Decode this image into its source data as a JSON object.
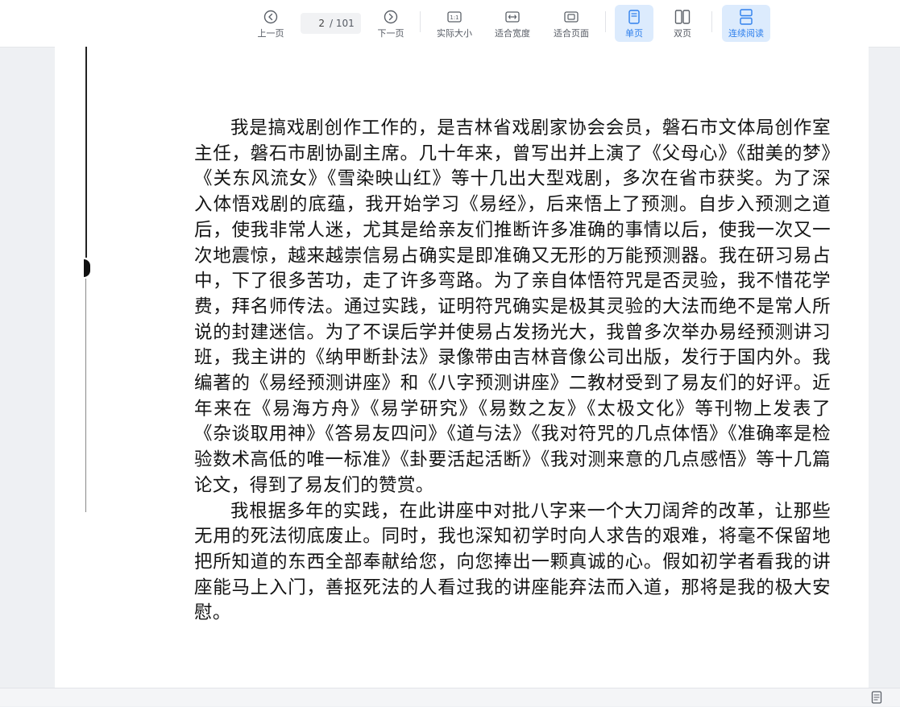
{
  "toolbar": {
    "prev_label": "上一页",
    "next_label": "下一页",
    "current_page": "2",
    "total_pages": "/ 101",
    "actual_size_label": "实际大小",
    "fit_width_label": "适合宽度",
    "fit_page_label": "适合页面",
    "single_page_label": "单页",
    "double_page_label": "双页",
    "continuous_label": "连续阅读",
    "icons": {
      "prev": "arrow-left-circle-icon",
      "next": "arrow-right-circle-icon",
      "actual_size": "one-to-one-icon",
      "fit_width": "fit-width-icon",
      "fit_page": "fit-page-icon",
      "single_page": "single-page-icon",
      "double_page": "double-page-icon",
      "continuous": "continuous-scroll-icon"
    },
    "accent_color": "#2f80ed"
  },
  "document": {
    "paragraphs": [
      "我是搞戏剧创作工作的，是吉林省戏剧家协会会员，磐石市文体局创作室主任，磐石市剧协副主席。几十年来，曾写出并上演了《父母心》《甜美的梦》《关东风流女》《雪染映山红》等十几出大型戏剧，多次在省市获奖。为了深入体悟戏剧的底蕴，我开始学习《易经》，后来悟上了预测。自步入预测之道后，使我非常人迷，尤其是给亲友们推断许多准确的事情以后，使我一次又一次地震惊，越来越崇信易占确实是即准确又无形的万能预测器。我在研习易占中，下了很多苦功，走了许多弯路。为了亲自体悟符咒是否灵验，我不惜花学费，拜名师传法。通过实践，证明符咒确实是极其灵验的大法而绝不是常人所说的封建迷信。为了不误后学并使易占发扬光大，我曾多次举办易经预测讲习班，我主讲的《纳甲断卦法》录像带由吉林音像公司出版，发行于国内外。我编著的《易经预测讲座》和《八字预测讲座》二教材受到了易友们的好评。近年来在《易海方舟》《易学研究》《易数之友》《太极文化》等刊物上发表了《杂谈取用神》《答易友四问》《道与法》《我对符咒的几点体悟》《准确率是检验数术高低的唯一标准》《卦要活起活断》《我对测来意的几点感悟》等十几篇论文，得到了易友们的赞赏。",
      "我根据多年的实践，在此讲座中对批八字来一个大刀阔斧的改革，让那些无用的死法彻底废止。同时，我也深知初学时向人求告的艰难，将毫不保留地把所知道的东西全部奉献给您，向您捧出一颗真诚的心。假如初学者看我的讲座能马上入门，善抠死法的人看过我的讲座能弃法而入道，那将是我的极大安慰。"
    ]
  },
  "statusbar": {
    "icon": "page-view-icon"
  }
}
